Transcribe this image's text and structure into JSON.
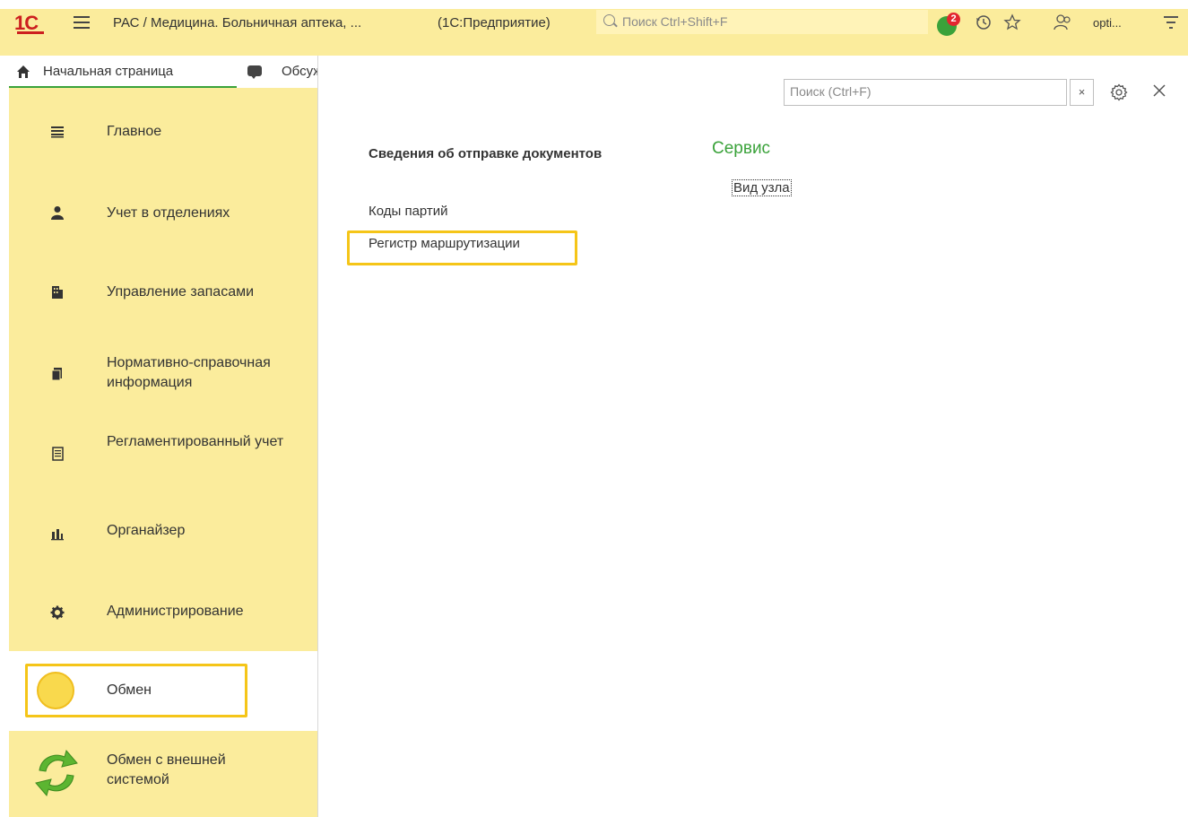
{
  "app": {
    "title": "РАС / Медицина. Больничная аптека, ...",
    "mode": "(1С:Предприятие)",
    "logo_text": "1С",
    "global_search_placeholder": "Поиск Ctrl+Shift+F",
    "notification_count": "2",
    "user_name": "opti..."
  },
  "tabs": [
    {
      "label": "Начальная страница",
      "icon": "home-icon"
    },
    {
      "label": "Обсуждения",
      "icon": "chat-icon"
    }
  ],
  "sidebar": {
    "items": [
      {
        "label": "Главное",
        "icon": "menu-lines-icon"
      },
      {
        "label": "Учет в отделениях",
        "icon": "person-icon"
      },
      {
        "label": "Управление запасами",
        "icon": "warehouse-icon"
      },
      {
        "label": "Нормативно-справочная информация",
        "icon": "books-icon"
      },
      {
        "label": "Регламентированный учет",
        "icon": "document-icon"
      },
      {
        "label": "Органайзер",
        "icon": "chart-bars-icon"
      },
      {
        "label": "Администрирование",
        "icon": "gear-icon"
      },
      {
        "label": "Обмен",
        "icon": "coin-icon",
        "active": true
      },
      {
        "label": "Обмен с внешней системой",
        "icon": "sync-arrows-icon"
      }
    ]
  },
  "main": {
    "search_placeholder": "Поиск (Ctrl+F)",
    "search_clear": "×",
    "sections": [
      {
        "title": "Сведения об отправке документов",
        "links": [
          "Коды партий",
          "Регистр маршрутизации"
        ]
      }
    ],
    "service": {
      "title": "Сервис",
      "links": [
        "Вид узла"
      ]
    }
  },
  "colors": {
    "sidebar_bg": "#fbec9c",
    "accent_green": "#3aa23a",
    "highlight_frame": "#f5c518",
    "badge_red": "#e3262f"
  }
}
